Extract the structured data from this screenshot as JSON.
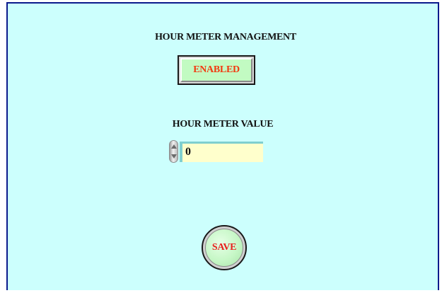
{
  "panel": {
    "title": "HOUR METER MANAGEMENT",
    "status_button": {
      "label": "ENABLED",
      "text_color": "#f23a10",
      "face_color": "#c2fbc2"
    },
    "value_section": {
      "label": "HOUR METER VALUE",
      "value": "0",
      "field_color": "#ffffcc",
      "spinner_icon": "up-down-spinner-icon"
    },
    "save_button": {
      "label": "SAVE",
      "text_color": "#e8201e"
    },
    "background_color": "#ccfffd",
    "border_color": "#0a1a8c"
  }
}
